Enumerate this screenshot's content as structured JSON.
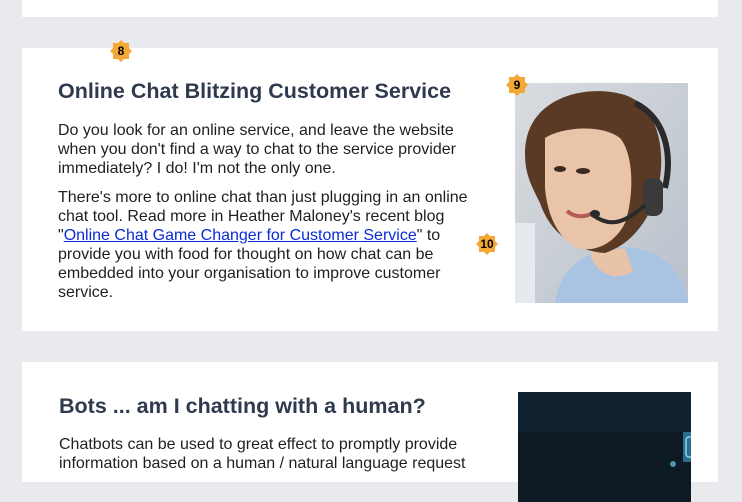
{
  "badges": {
    "b8": "8",
    "b9": "9",
    "b10": "10"
  },
  "article1": {
    "title": "Online Chat Blitzing Customer Service",
    "para1": "Do you look for an online service, and leave the website when you don't find a way to chat to the service provider immediately?  I do!  I'm not the only one.",
    "para2_before": "There's more to online chat than just plugging in an online chat tool.  Read more in Heather Maloney's recent blog \"",
    "link_text": "Online Chat Game Changer for Customer Service",
    "para2_after": "\" to provide you with food for thought on how chat can be embedded into your organisation to improve customer service.",
    "image_icon": "headset-agent-photo"
  },
  "article2": {
    "title": "Bots ... am I chatting with a human?",
    "para1": "Chatbots can be used to great effect to promptly provide information based on a human / natural language request",
    "image_icon": "chatbot-tech-photo"
  },
  "colors": {
    "page_bg": "#e9eaed",
    "card_bg": "#ffffff",
    "heading": "#2f3a4f",
    "link": "#0a2bd6",
    "badge": "#f4a838"
  }
}
